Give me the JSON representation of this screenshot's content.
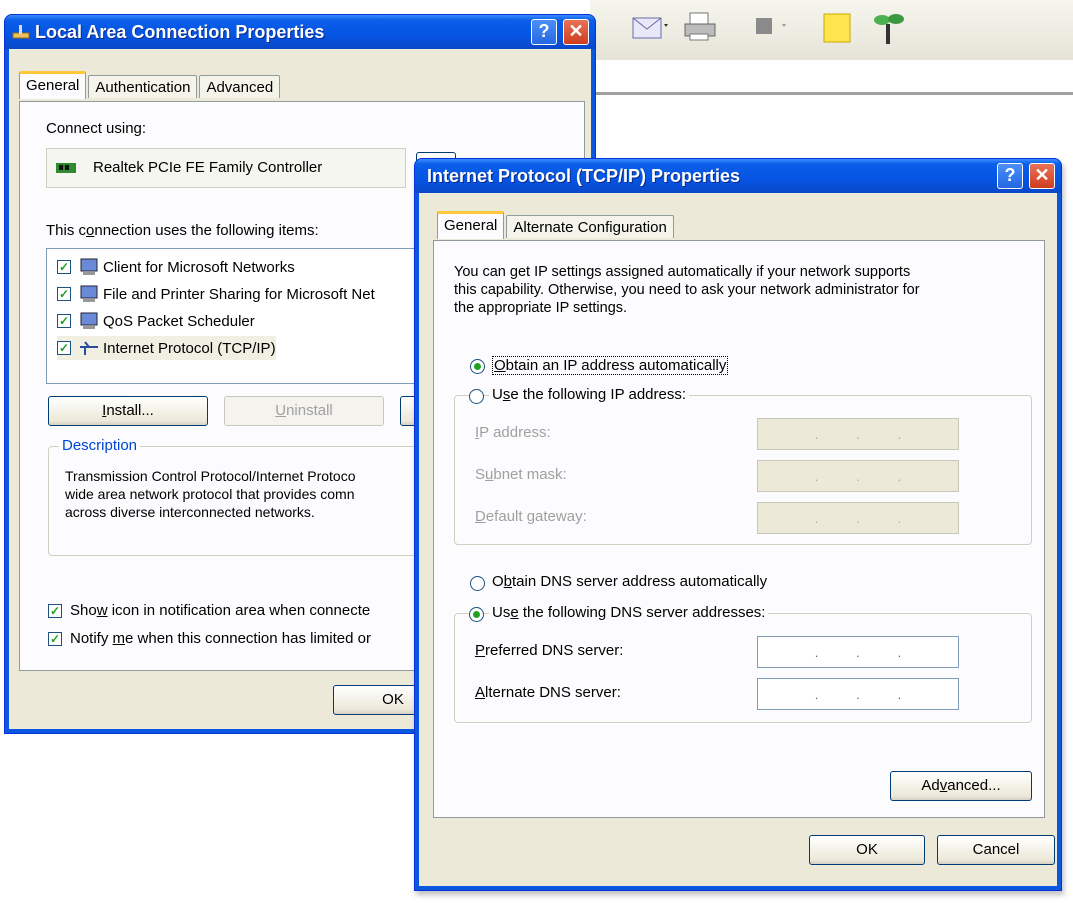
{
  "lac": {
    "title": "Local Area Connection Properties",
    "help": "?",
    "close": "✕",
    "tabs": [
      "General",
      "Authentication",
      "Advanced"
    ],
    "connect_using": "Connect using:",
    "adapter": "Realtek PCIe FE Family Controller",
    "items_label": "This connection uses the following items:",
    "items": [
      {
        "label": "Client for Microsoft Networks",
        "checked": true
      },
      {
        "label": "File and Printer Sharing for Microsoft Net",
        "checked": true
      },
      {
        "label": "QoS Packet Scheduler",
        "checked": true
      },
      {
        "label": "Internet Protocol (TCP/IP)",
        "checked": true
      }
    ],
    "install": "Install...",
    "uninstall": "Uninstall",
    "description_title": "Description",
    "description": [
      "Transmission Control Protocol/Internet Protoco",
      "wide area network protocol that provides comn",
      "across diverse interconnected networks."
    ],
    "show_icon": "Show icon in notification area when connecte",
    "notify": "Notify me when this connection has limited or",
    "ok": "OK"
  },
  "tcp": {
    "title": "Internet Protocol (TCP/IP) Properties",
    "help": "?",
    "close": "✕",
    "tabs": [
      "General",
      "Alternate Configuration"
    ],
    "intro": [
      "You can get IP settings assigned automatically if your network supports",
      "this capability. Otherwise, you need to ask your network administrator for",
      "the appropriate IP settings."
    ],
    "obtain_ip": "Obtain an IP address automatically",
    "use_ip": "Use the following IP address:",
    "ip_address": "IP address:",
    "subnet_mask": "Subnet mask:",
    "default_gateway": "Default gateway:",
    "obtain_dns": "Obtain DNS server address automatically",
    "use_dns": "Use the following DNS server addresses:",
    "preferred_dns": "Preferred DNS server:",
    "alternate_dns": "Alternate DNS server:",
    "ip_dots": ".",
    "advanced": "Advanced...",
    "ok": "OK",
    "cancel": "Cancel"
  }
}
